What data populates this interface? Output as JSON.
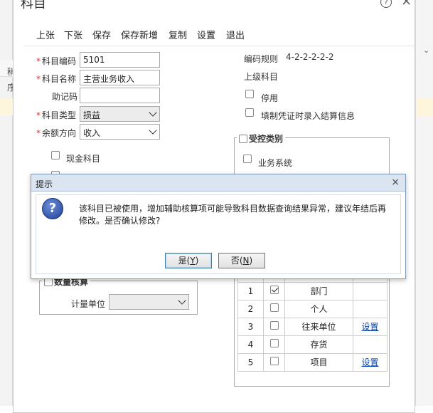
{
  "background": {
    "left_labels": [
      "稍",
      "序"
    ]
  },
  "window": {
    "title": "科目",
    "help": "?",
    "close": "×"
  },
  "toolbar": {
    "prev": "上张",
    "next": "下张",
    "save": "保存",
    "save_new": "保存新增",
    "copy": "复制",
    "settings": "设置",
    "exit": "退出"
  },
  "form": {
    "code_label": "科目编码",
    "code_value": "5101",
    "name_label": "科目名称",
    "name_value": "主营业务收入",
    "mnemonic_label": "助记码",
    "mnemonic_value": "",
    "type_label": "科目类型",
    "type_value": "损益",
    "direction_label": "余额方向",
    "direction_value": "收入",
    "cash_label": "现金科目",
    "code_rule_label": "编码规则",
    "code_rule_value": "4-2-2-2-2-2",
    "parent_label": "上级科目",
    "disabled_label": "停用",
    "settlement_label": "填制凭证时录入结算信息"
  },
  "controlled": {
    "legend": "受控类别",
    "business_label": "业务系统"
  },
  "quantity": {
    "legend": "数量核算",
    "unit_label": "计量单位",
    "unit_value": ""
  },
  "aux_table": {
    "rows": [
      {
        "num": "1",
        "checked": true,
        "name": "部门",
        "action": ""
      },
      {
        "num": "2",
        "checked": false,
        "name": "个人",
        "action": ""
      },
      {
        "num": "3",
        "checked": false,
        "name": "往来单位",
        "action": "设置"
      },
      {
        "num": "4",
        "checked": false,
        "name": "存货",
        "action": ""
      },
      {
        "num": "5",
        "checked": false,
        "name": "项目",
        "action": "设置"
      }
    ]
  },
  "dialog": {
    "title": "提示",
    "close": "×",
    "message": "该科目已被使用，增加辅助核算项可能导致科目数据查询结果异常，建议年结后再修改。是否确认修改?",
    "yes_prefix": "是(",
    "yes_key": "Y",
    "yes_suffix": ")",
    "no_prefix": "否(",
    "no_key": "N",
    "no_suffix": ")"
  }
}
